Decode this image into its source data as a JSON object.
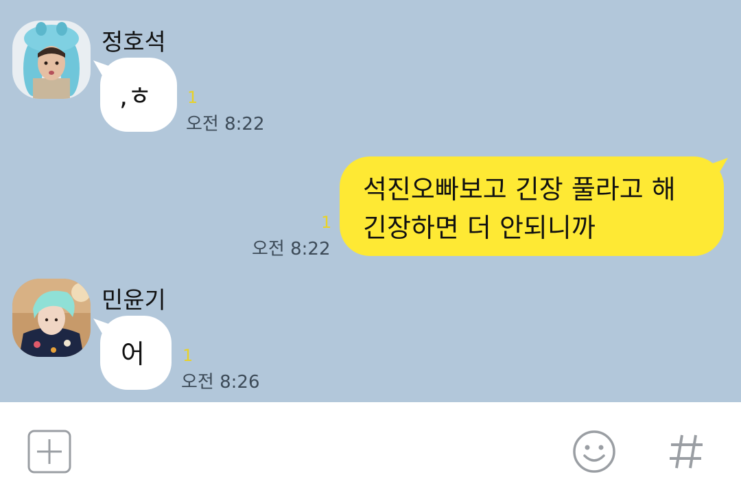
{
  "messages": [
    {
      "sender": "정호석",
      "text": ",ㅎ",
      "unread": "1",
      "time": "오전 8:22",
      "direction": "incoming"
    },
    {
      "text_lines": [
        "석진오빠보고 긴장 풀라고 해",
        "긴장하면 더 안되니까"
      ],
      "unread": "1",
      "time": "오전 8:22",
      "direction": "outgoing"
    },
    {
      "sender": "민윤기",
      "text": "어",
      "unread": "1",
      "time": "오전 8:26",
      "direction": "incoming"
    }
  ],
  "composer": {
    "add_icon": "plus-square-icon",
    "emoji_icon": "smiley-icon",
    "hashtag_icon": "hashtag-icon"
  },
  "colors": {
    "chat_background": "#b2c7da",
    "outgoing_bubble": "#fee934",
    "incoming_bubble": "#ffffff",
    "unread_count": "#e9d226",
    "composer_icons": "#9a9ea3"
  }
}
